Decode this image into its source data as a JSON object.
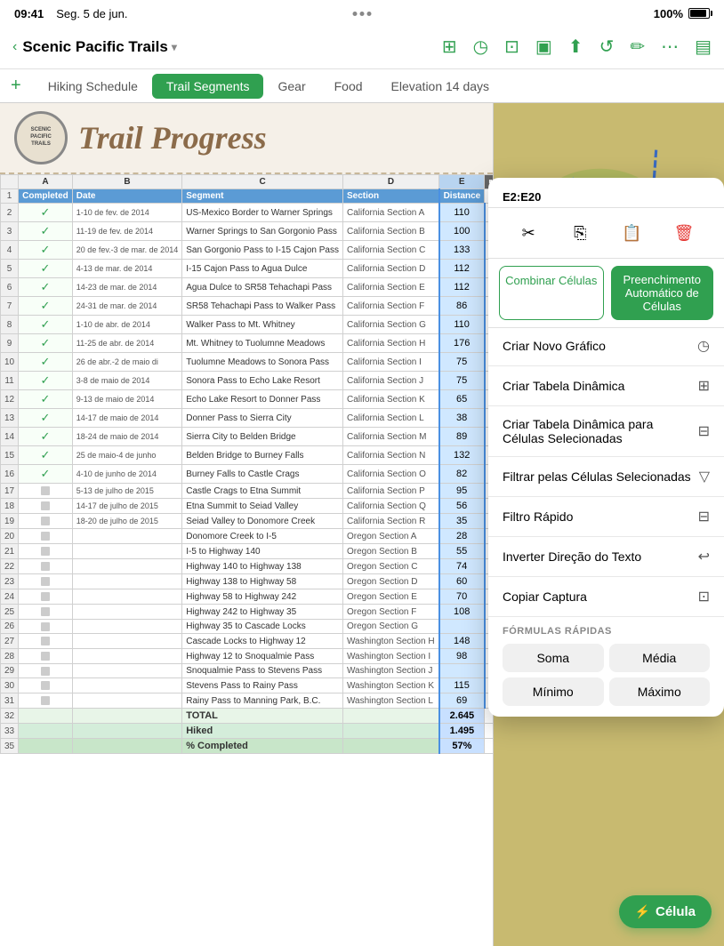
{
  "statusBar": {
    "time": "09:41",
    "date": "Seg. 5 de jun.",
    "battery": "100%"
  },
  "navBar": {
    "backLabel": "‹",
    "title": "Scenic Pacific Trails",
    "chevron": "▾"
  },
  "tabs": {
    "addIcon": "+",
    "items": [
      {
        "label": "Hiking Schedule",
        "active": false
      },
      {
        "label": "Trail Segments",
        "active": true
      },
      {
        "label": "Gear",
        "active": false
      },
      {
        "label": "Food",
        "active": false
      },
      {
        "label": "Elevation 14 days",
        "active": false
      }
    ]
  },
  "trailHeader": {
    "logoLines": [
      "SCENIC",
      "PACIFIC",
      "TRAILS"
    ],
    "title": "Trail Progress"
  },
  "columns": [
    "Completed",
    "Date",
    "Segment",
    "Section",
    "Distance"
  ],
  "columnLetters": [
    "A",
    "B",
    "C",
    "D",
    "E"
  ],
  "rows": [
    {
      "row": 2,
      "completed": true,
      "date": "1-10 de fev. de 2014",
      "segment": "US-Mexico Border to Warner Springs",
      "section": "California Section A",
      "distance": "110"
    },
    {
      "row": 3,
      "completed": true,
      "date": "11-19 de fev. de 2014",
      "segment": "Warner Springs to San Gorgonio Pass",
      "section": "California Section B",
      "distance": "100"
    },
    {
      "row": 4,
      "completed": true,
      "date": "20 de fev.-3 de mar. de 2014",
      "segment": "San Gorgonio Pass to I-15 Cajon Pass",
      "section": "California Section C",
      "distance": "133"
    },
    {
      "row": 5,
      "completed": true,
      "date": "4-13 de mar. de 2014",
      "segment": "I-15 Cajon Pass to Agua Dulce",
      "section": "California Section D",
      "distance": "112"
    },
    {
      "row": 6,
      "completed": true,
      "date": "14-23 de mar. de 2014",
      "segment": "Agua Dulce to SR58 Tehachapi Pass",
      "section": "California Section E",
      "distance": "112"
    },
    {
      "row": 7,
      "completed": true,
      "date": "24-31 de mar. de 2014",
      "segment": "SR58 Tehachapi Pass to Walker Pass",
      "section": "California Section F",
      "distance": "86"
    },
    {
      "row": 8,
      "completed": true,
      "date": "1-10 de abr. de 2014",
      "segment": "Walker Pass to Mt. Whitney",
      "section": "California Section G",
      "distance": "110"
    },
    {
      "row": 9,
      "completed": true,
      "date": "11-25 de abr. de 2014",
      "segment": "Mt. Whitney to Tuolumne Meadows",
      "section": "California Section H",
      "distance": "176"
    },
    {
      "row": 10,
      "completed": true,
      "date": "26 de abr.-2 de maio di",
      "segment": "Tuolumne Meadows to Sonora Pass",
      "section": "California Section I",
      "distance": "75"
    },
    {
      "row": 11,
      "completed": true,
      "date": "3-8 de maio de 2014",
      "segment": "Sonora Pass to Echo Lake Resort",
      "section": "California Section J",
      "distance": "75"
    },
    {
      "row": 12,
      "completed": true,
      "date": "9-13 de maio de 2014",
      "segment": "Echo Lake Resort to Donner Pass",
      "section": "California Section K",
      "distance": "65"
    },
    {
      "row": 13,
      "completed": true,
      "date": "14-17 de maio de 2014",
      "segment": "Donner Pass to Sierra City",
      "section": "California Section L",
      "distance": "38"
    },
    {
      "row": 14,
      "completed": true,
      "date": "18-24 de maio de 2014",
      "segment": "Sierra City to Belden Bridge",
      "section": "California Section M",
      "distance": "89"
    },
    {
      "row": 15,
      "completed": true,
      "date": "25 de maio-4 de junho",
      "segment": "Belden Bridge to Burney Falls",
      "section": "California Section N",
      "distance": "132"
    },
    {
      "row": 16,
      "completed": true,
      "date": "4-10 de junho de 2014",
      "segment": "Burney Falls to Castle Crags",
      "section": "California Section O",
      "distance": "82"
    },
    {
      "row": 17,
      "completed": false,
      "date": "5-13 de julho de 2015",
      "segment": "Castle Crags to Etna Summit",
      "section": "California Section P",
      "distance": "95"
    },
    {
      "row": 18,
      "completed": false,
      "date": "14-17 de julho de 2015",
      "segment": "Etna Summit to Seiad Valley",
      "section": "California Section Q",
      "distance": "56"
    },
    {
      "row": 19,
      "completed": false,
      "date": "18-20 de julho de 2015",
      "segment": "Seiad Valley to Donomore Creek",
      "section": "California Section R",
      "distance": "35"
    },
    {
      "row": 20,
      "completed": false,
      "date": "",
      "segment": "Donomore Creek to I-5",
      "section": "Oregon Section A",
      "distance": "28"
    },
    {
      "row": 21,
      "completed": false,
      "date": "",
      "segment": "I-5 to Highway 140",
      "section": "Oregon Section B",
      "distance": "55"
    },
    {
      "row": 22,
      "completed": false,
      "date": "",
      "segment": "Highway 140 to Highway 138",
      "section": "Oregon Section C",
      "distance": "74"
    },
    {
      "row": 23,
      "completed": false,
      "date": "",
      "segment": "Highway 138 to Highway 58",
      "section": "Oregon Section D",
      "distance": "60"
    },
    {
      "row": 24,
      "completed": false,
      "date": "",
      "segment": "Highway 58 to Highway 242",
      "section": "Oregon Section E",
      "distance": "70"
    },
    {
      "row": 25,
      "completed": false,
      "date": "",
      "segment": "Highway 242 to Highway 35",
      "section": "Oregon Section F",
      "distance": "108"
    },
    {
      "row": 26,
      "completed": false,
      "date": "",
      "segment": "Highway 35 to Cascade Locks",
      "section": "Oregon Section G",
      "distance": ""
    },
    {
      "row": 27,
      "completed": false,
      "date": "",
      "segment": "Cascade Locks to Highway 12",
      "section": "Washington Section H",
      "distance": "148"
    },
    {
      "row": 28,
      "completed": false,
      "date": "",
      "segment": "Highway 12 to Snoqualmie Pass",
      "section": "Washington Section I",
      "distance": "98"
    },
    {
      "row": 29,
      "completed": false,
      "date": "",
      "segment": "Snoqualmie Pass to Stevens Pass",
      "section": "Washington Section J",
      "distance": ""
    },
    {
      "row": 30,
      "completed": false,
      "date": "",
      "segment": "Stevens Pass to Rainy Pass",
      "section": "Washington Section K",
      "distance": "115"
    },
    {
      "row": 31,
      "completed": false,
      "date": "",
      "segment": "Rainy Pass to Manning Park, B.C.",
      "section": "Washington Section L",
      "distance": "69"
    }
  ],
  "summaryRows": [
    {
      "row": 32,
      "label": "TOTAL",
      "value": "2.645",
      "type": "total"
    },
    {
      "row": 33,
      "label": "Hiked",
      "value": "1.495",
      "type": "hiked"
    },
    {
      "row": 35,
      "label": "% Completed",
      "value": "57%",
      "type": "percent"
    }
  ],
  "contextMenu": {
    "header": "E2:E20",
    "icons": [
      "✂",
      "⎘",
      "⊡",
      "🗑"
    ],
    "buttons": [
      "Combinar Células",
      "Preenchimento Automático de Células"
    ],
    "items": [
      {
        "label": "Criar Novo Gráfico",
        "icon": "⊙"
      },
      {
        "label": "Criar Tabela Dinâmica",
        "icon": "⊞"
      },
      {
        "label": "Criar Tabela Dinâmica para Células Selecionadas",
        "icon": "⊟"
      },
      {
        "label": "Filtrar pelas Células Selecionadas",
        "icon": "⊽"
      },
      {
        "label": "Filtro Rápido",
        "icon": "⊟"
      },
      {
        "label": "Inverter Direção do Texto",
        "icon": "↩"
      },
      {
        "label": "Copiar Captura",
        "icon": "⊡"
      }
    ],
    "formulasTitle": "FÓRMULAS RÁPIDAS",
    "formulas": [
      "Soma",
      "Média",
      "Mínimo",
      "Máximo"
    ]
  },
  "celulaButton": "⚡  Célula"
}
